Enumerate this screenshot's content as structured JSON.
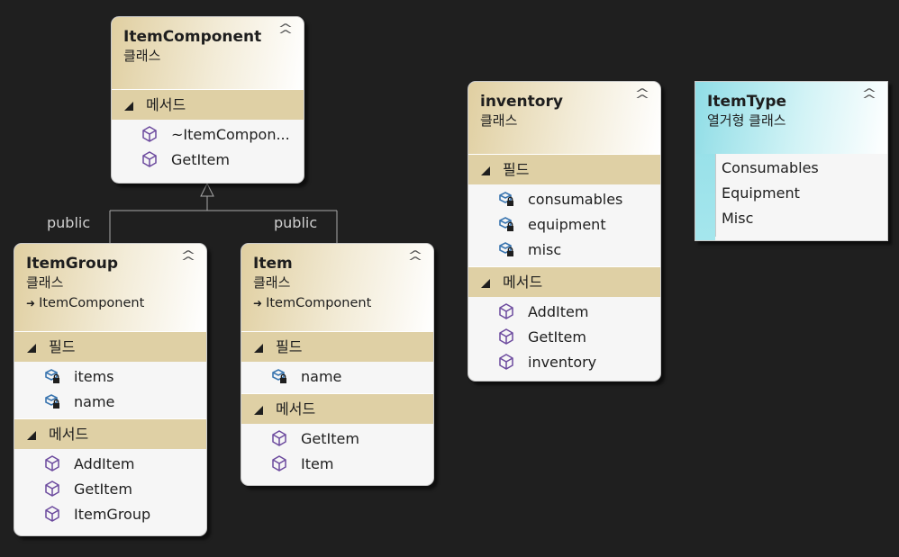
{
  "relation_label": "public",
  "classes": [
    {
      "name": "ItemComponent",
      "kind": "클래스",
      "methods_label": "메서드",
      "methods": [
        "~ItemCompon...",
        "GetItem"
      ]
    },
    {
      "name": "ItemGroup",
      "kind": "클래스",
      "base": "ItemComponent",
      "fields_label": "필드",
      "fields": [
        "items",
        "name"
      ],
      "methods_label": "메서드",
      "methods": [
        "AddItem",
        "GetItem",
        "ItemGroup"
      ]
    },
    {
      "name": "Item",
      "kind": "클래스",
      "base": "ItemComponent",
      "fields_label": "필드",
      "fields": [
        "name"
      ],
      "methods_label": "메서드",
      "methods": [
        "GetItem",
        "Item"
      ]
    },
    {
      "name": "inventory",
      "kind": "클래스",
      "fields_label": "필드",
      "fields": [
        "consumables",
        "equipment",
        "misc"
      ],
      "methods_label": "메서드",
      "methods": [
        "AddItem",
        "GetItem",
        "inventory"
      ]
    }
  ],
  "enum": {
    "name": "ItemType",
    "kind": "열거형 클래스",
    "values": [
      "Consumables",
      "Equipment",
      "Misc"
    ]
  },
  "colors": {
    "background": "#1f1f1f",
    "class_header": "#dfd0a5",
    "enum_header": "#8fdde6",
    "method_icon": "#6c4a9e",
    "field_icon": "#3b76b0"
  }
}
